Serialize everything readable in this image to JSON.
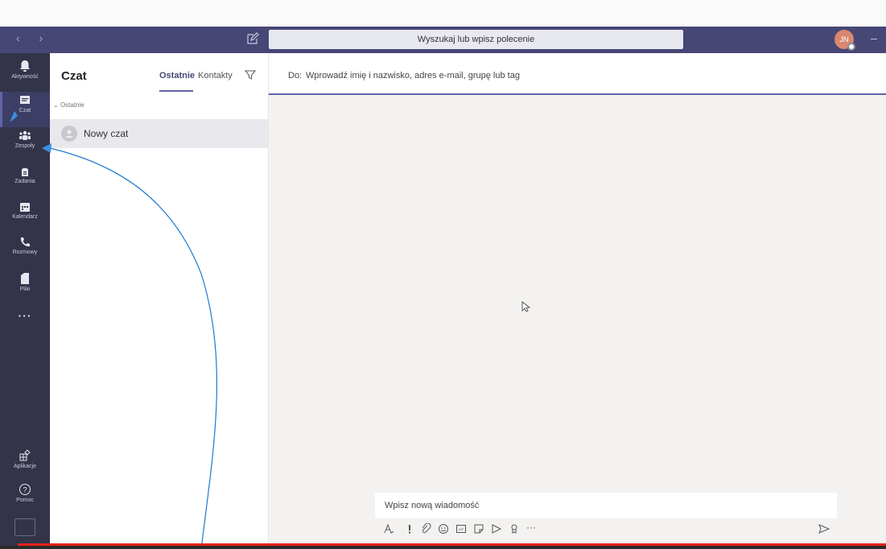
{
  "window": {
    "search_placeholder": "Wyszukaj lub wpisz polecenie",
    "user_initials": "JN",
    "minimize_glyph": "–",
    "nav_glyphs": "‹ ›"
  },
  "rail": {
    "items": [
      {
        "label": "Aktywność",
        "icon": "bell-icon"
      },
      {
        "label": "Czat",
        "icon": "chat-icon",
        "active": true
      },
      {
        "label": "Zespoły",
        "icon": "teams-icon"
      },
      {
        "label": "Zadania",
        "icon": "assignments-icon"
      },
      {
        "label": "Kalendarz",
        "icon": "calendar-icon"
      },
      {
        "label": "Rozmowy",
        "icon": "phone-icon"
      },
      {
        "label": "Pliki",
        "icon": "file-icon"
      }
    ],
    "more": "···",
    "apps_label": "Aplikacje",
    "help_label": "Pomoc"
  },
  "chatlist": {
    "title": "Czat",
    "tabs": [
      "Ostatnie",
      "Kontakty"
    ],
    "active_tab": "Ostatnie",
    "section": "Ostatnie",
    "items": [
      {
        "name": "Nowy czat"
      }
    ]
  },
  "main": {
    "to_label": "Do:",
    "to_placeholder": "Wprowadź imię i nazwisko, adres e-mail, grupę lub tag",
    "composer_placeholder": "Wpisz nową wiadomość",
    "more_glyph": "···"
  },
  "colors": {
    "accent": "#6264a7",
    "topbar": "#464775",
    "rail": "#33344a",
    "annotation": "#1e7ad0",
    "red_bar": "#e2221a"
  }
}
